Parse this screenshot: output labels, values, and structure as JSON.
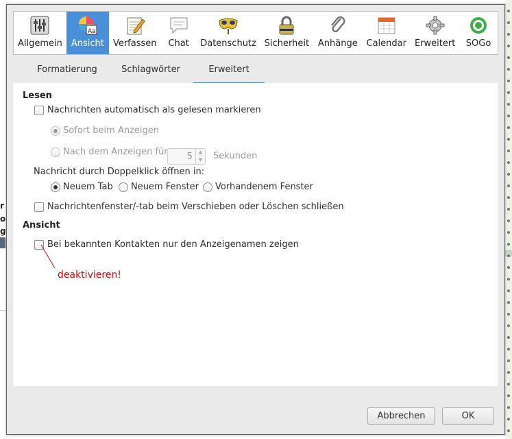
{
  "background": {
    "left_fragments": [
      "r",
      "o",
      "g"
    ]
  },
  "toolbar": {
    "items": [
      {
        "label": "Allgemein",
        "icon": "sliders-icon"
      },
      {
        "label": "Ansicht",
        "icon": "color-font-icon",
        "active": true
      },
      {
        "label": "Verfassen",
        "icon": "notepad-pencil-icon"
      },
      {
        "label": "Chat",
        "icon": "chat-bubble-icon"
      },
      {
        "label": "Datenschutz",
        "icon": "mask-icon"
      },
      {
        "label": "Sicherheit",
        "icon": "padlock-icon"
      },
      {
        "label": "Anhänge",
        "icon": "paperclip-icon"
      },
      {
        "label": "Calendar",
        "icon": "calendar-icon"
      },
      {
        "label": "Erweitert",
        "icon": "gear-icon"
      },
      {
        "label": "SOGo",
        "icon": "sogo-ring-icon"
      }
    ]
  },
  "subtabs": [
    {
      "label": "Formatierung"
    },
    {
      "label": "Schlagwörter"
    },
    {
      "label": "Erweitert",
      "active": true
    }
  ],
  "panel": {
    "lesen_title": "Lesen",
    "auto_mark": {
      "label": "Nachrichten automatisch als gelesen markieren",
      "checked": false
    },
    "sofort": {
      "label": "Sofort beim Anzeigen",
      "selected": true,
      "disabled": true
    },
    "nach": {
      "label": "Nach dem Anzeigen für",
      "selected": false,
      "disabled": true
    },
    "seconds_value": "5",
    "seconds_unit": "Sekunden",
    "doubleclick_label": "Nachricht durch Doppelklick öffnen in:",
    "open_in": [
      {
        "label": "Neuem Tab",
        "selected": true
      },
      {
        "label": "Neuem Fenster",
        "selected": false
      },
      {
        "label": "Vorhandenem Fenster",
        "selected": false
      }
    ],
    "close_on_move": {
      "label": "Nachrichtenfenster/-tab beim Verschieben oder Löschen schließen",
      "checked": false
    },
    "ansicht_title": "Ansicht",
    "display_names": {
      "label": "Bei bekannten Kontakten nur den Anzeigenamen zeigen",
      "checked": false
    },
    "annotation": "deaktivieren!"
  },
  "buttons": {
    "cancel": "Abbrechen",
    "ok": "OK"
  },
  "colors": {
    "accent": "#4a90d9",
    "annotation": "#e00000",
    "dialog_bg": "#eaeaea"
  }
}
